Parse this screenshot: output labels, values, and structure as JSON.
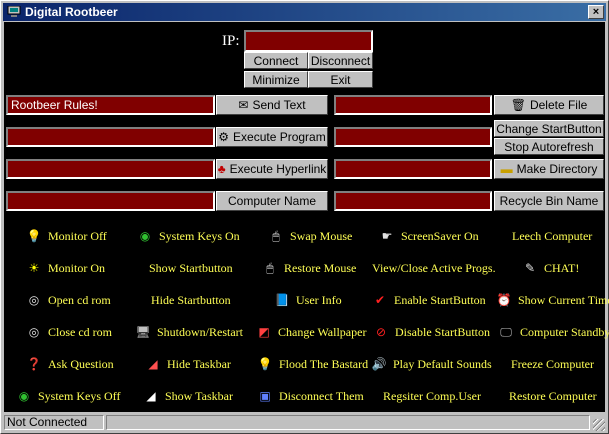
{
  "window": {
    "title": "Digital Rootbeer",
    "close_glyph": "×"
  },
  "ip": {
    "label": "IP:",
    "value": ""
  },
  "connection": {
    "connect": "Connect",
    "disconnect": "Disconnect",
    "minimize": "Minimize",
    "exit": "Exit"
  },
  "actions": {
    "message_text": "Rootbeer Rules!",
    "send_text": "Send Text",
    "execute_program": "Execute Program",
    "execute_hyperlink": "Execute Hyperlink",
    "computer_name": "Computer Name",
    "delete_file": "Delete File",
    "change_startbutton": "Change StartButton",
    "stop_autorefresh": "Stop Autorefresh",
    "make_directory": "Make Directory",
    "recycle_bin_name": "Recycle Bin Name"
  },
  "commands": {
    "monitor_off": "Monitor Off",
    "monitor_on": "Monitor On",
    "open_cdrom": "Open cd rom",
    "close_cdrom": "Close cd rom",
    "ask_question": "Ask Question",
    "system_keys_off": "System Keys Off",
    "system_keys_on": "System Keys On",
    "show_startbutton": "Show Startbutton",
    "hide_startbutton": "Hide Startbutton",
    "shutdown_restart": "Shutdown/Restart",
    "hide_taskbar": "Hide Taskbar",
    "show_taskbar": "Show Taskbar",
    "swap_mouse": "Swap Mouse",
    "restore_mouse": "Restore Mouse",
    "user_info": "User Info",
    "change_wallpaper": "Change Wallpaper",
    "flood_the_bastard": "Flood The Bastard",
    "disconnect_them": "Disconnect Them",
    "screensaver_on": "ScreenSaver On",
    "view_close_active": "View/Close Active Progs.",
    "enable_startbutton": "Enable StartButton",
    "disable_startbutton": "Disable StartButton",
    "play_default_sounds": "Play Default Sounds",
    "register_comp_user": "Regsiter Comp.User",
    "leech_computer": "Leech Computer",
    "chat": "CHAT!",
    "show_current_time": "Show Current Time",
    "computer_standby": "Computer Standby",
    "freeze_computer": "Freeze Computer",
    "restore_computer": "Restore Computer"
  },
  "status": {
    "connection": "Not Connected"
  },
  "colors": {
    "field_bg": "#800000",
    "command_text": "#ffff55",
    "client_bg": "#000000",
    "title_bar": "#0a246a"
  }
}
